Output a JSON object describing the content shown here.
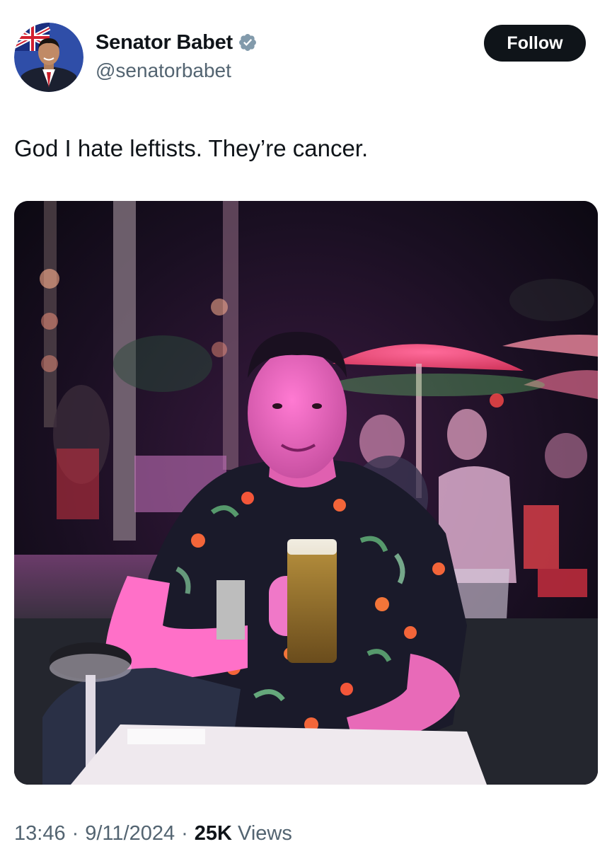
{
  "author": {
    "display_name": "Senator Babet",
    "handle": "@senatorbabet",
    "verified": true,
    "avatar_icon": "profile-photo"
  },
  "follow_label": "Follow",
  "tweet": {
    "text": "God I hate leftists. They’re cancer."
  },
  "media": {
    "kind": "photo",
    "icon": "photo-image"
  },
  "meta": {
    "time": "13:46",
    "separator": "·",
    "date": "9/11/2024",
    "views_count": "25K",
    "views_label": "Views"
  },
  "colors": {
    "text": "#0f1419",
    "secondary": "#536471",
    "verified": "#829aab",
    "button_bg": "#0f1419",
    "button_text": "#ffffff"
  }
}
